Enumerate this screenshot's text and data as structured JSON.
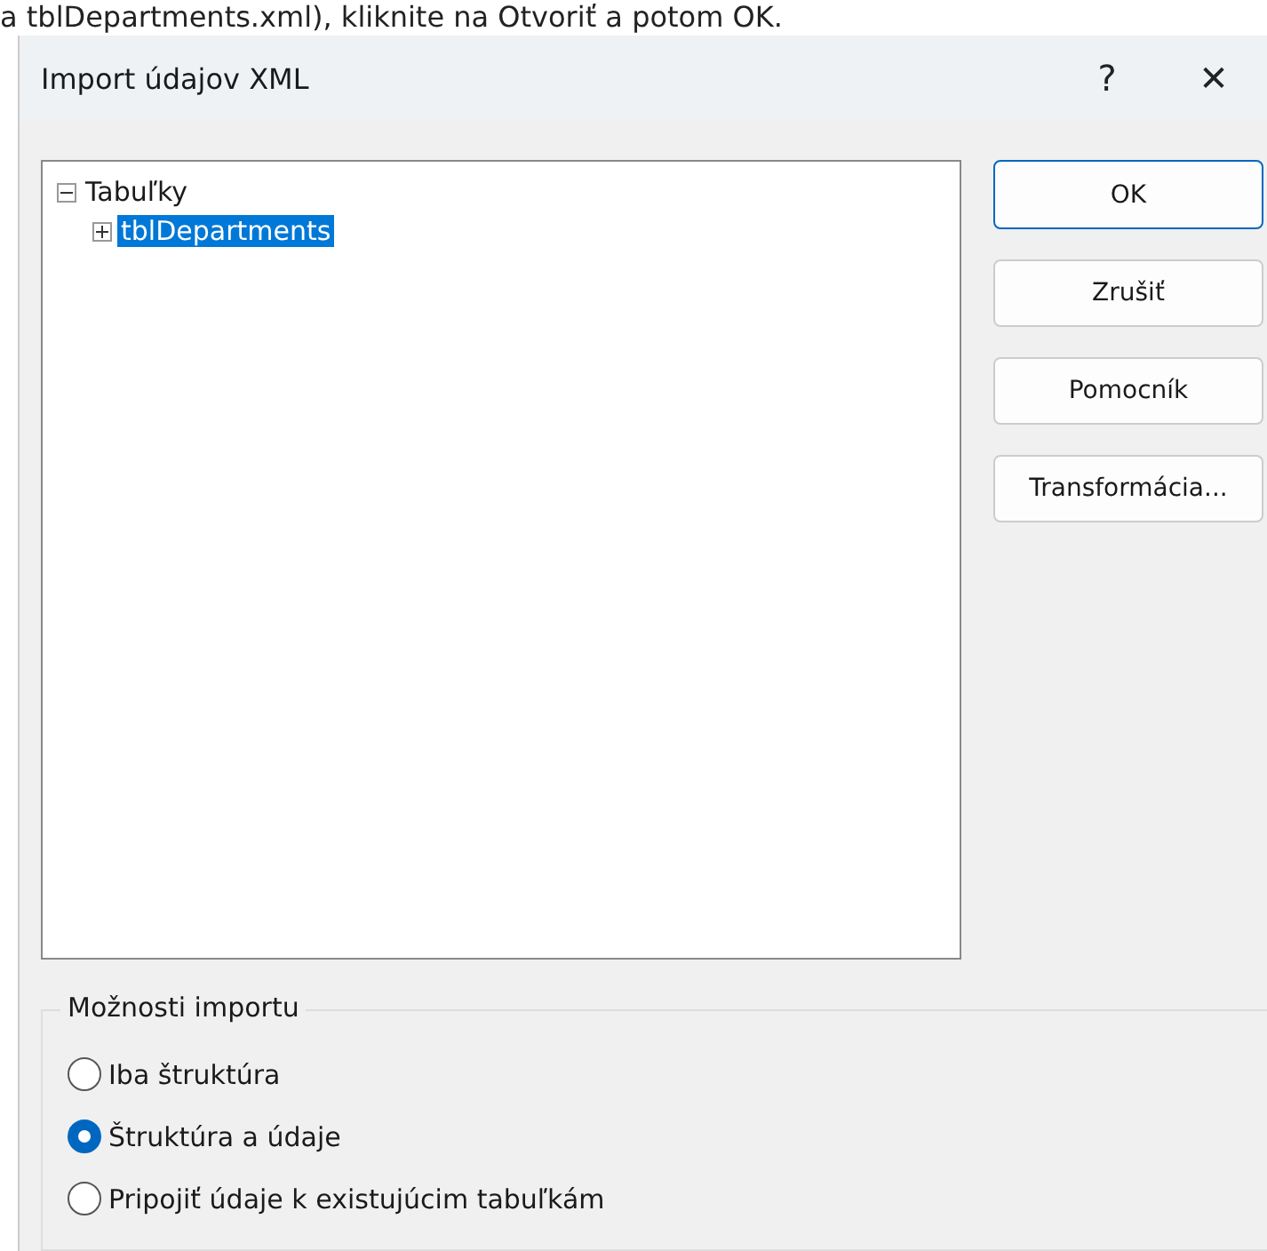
{
  "background_text": "a tblDepartments.xml), kliknite na Otvoriť a potom OK.",
  "window": {
    "title": "Import údajov XML",
    "help_button": "?",
    "close_button": "✕"
  },
  "tree": [
    {
      "label": "Tabuľky",
      "expanded": true,
      "selected": false,
      "children": [
        {
          "label": "tblDepartments",
          "expanded": false,
          "selected": true
        }
      ]
    }
  ],
  "buttons": [
    {
      "label": "OK",
      "default": true
    },
    {
      "label": "Zrušiť",
      "default": false
    },
    {
      "label": "Pomocník",
      "default": false
    },
    {
      "label": "Transformácia...",
      "default": false
    }
  ],
  "import_options": {
    "title": "Možnosti importu",
    "options": [
      {
        "label": "Iba štruktúra",
        "selected": false
      },
      {
        "label": "Štruktúra a údaje",
        "selected": true
      },
      {
        "label": "Pripojiť údaje k existujúcim tabuľkám",
        "selected": false
      }
    ]
  }
}
